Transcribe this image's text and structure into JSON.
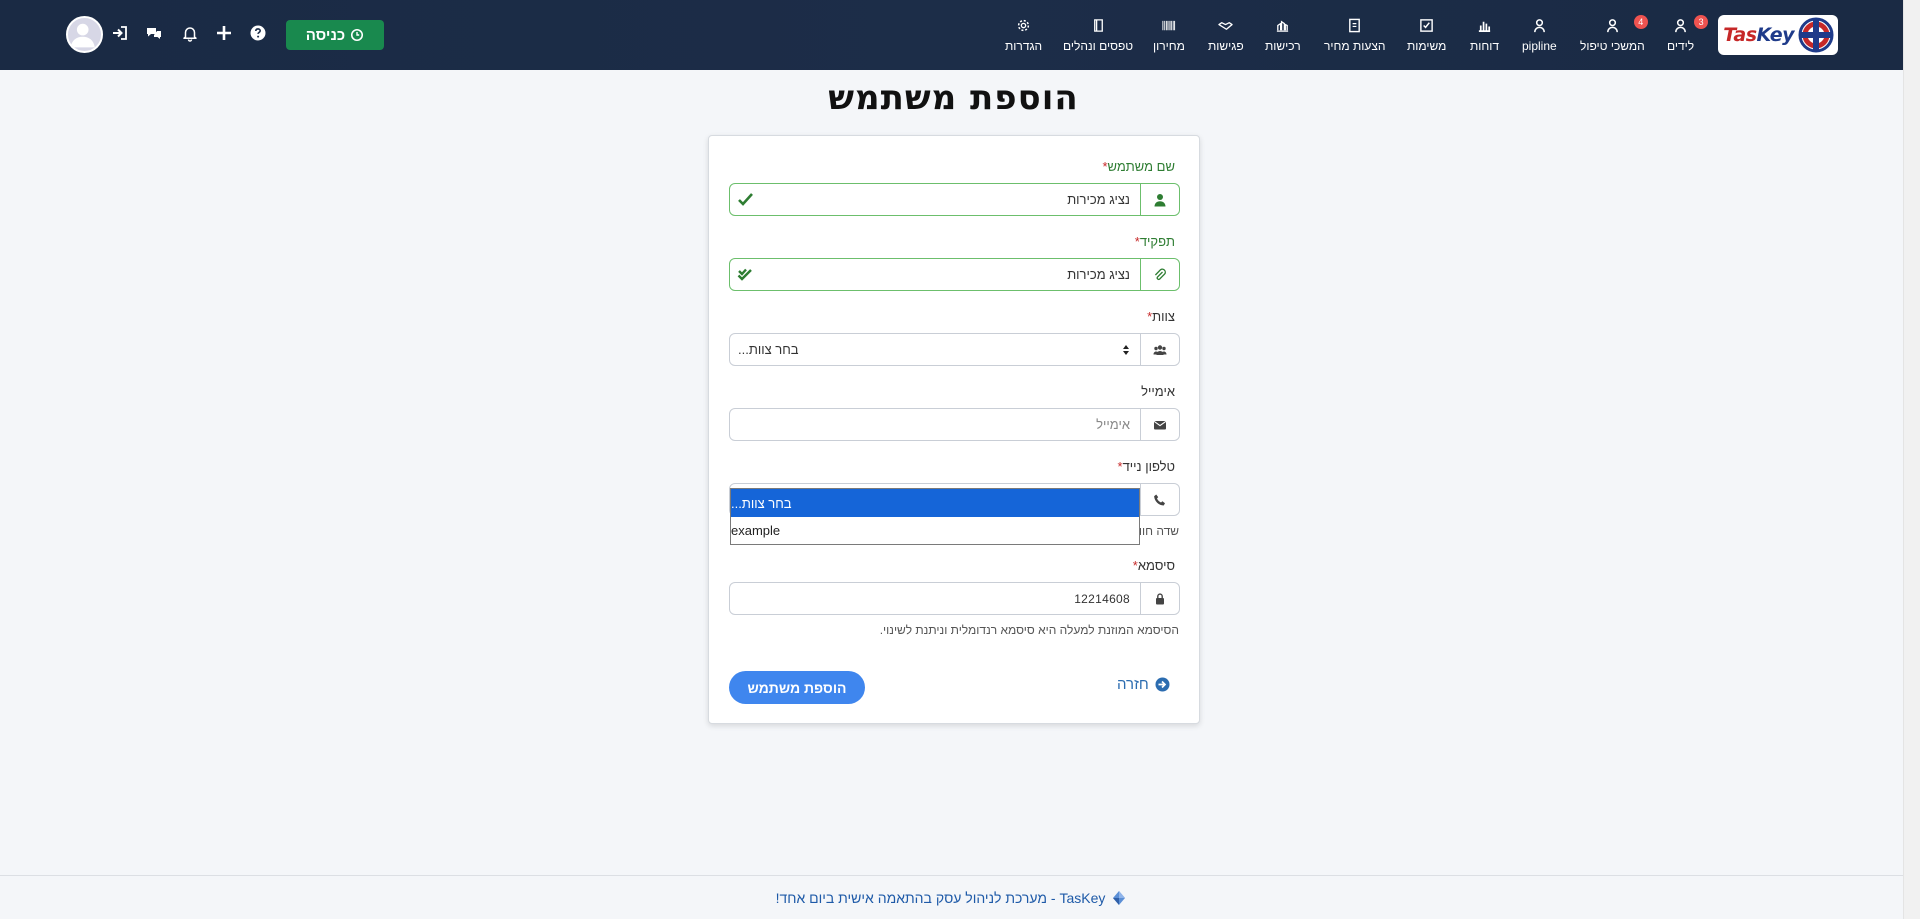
{
  "app": {
    "logo_text_a": "Tas",
    "logo_text_b": "Key"
  },
  "nav": {
    "items": [
      {
        "key": "leads",
        "label": "לידים",
        "icon": "user-icon",
        "badge": "3"
      },
      {
        "key": "followups",
        "label": "המשכי טיפול",
        "icon": "user-icon",
        "badge": "4"
      },
      {
        "key": "pipeline",
        "label": "pipline",
        "icon": "user-icon",
        "badge": ""
      },
      {
        "key": "reports",
        "label": "דוחות",
        "icon": "bar-chart-icon",
        "badge": ""
      },
      {
        "key": "tasks",
        "label": "משימות",
        "icon": "check-square-icon",
        "badge": ""
      },
      {
        "key": "quotes",
        "label": "הצעות מחיר",
        "icon": "document-icon",
        "badge": ""
      },
      {
        "key": "purchases",
        "label": "רכישות",
        "icon": "purchases-icon",
        "badge": ""
      },
      {
        "key": "meetings",
        "label": "פגישות",
        "icon": "handshake-icon",
        "badge": ""
      },
      {
        "key": "pricelist",
        "label": "מחירון",
        "icon": "barcode-icon",
        "badge": ""
      },
      {
        "key": "forms",
        "label": "טפסים ונהלים",
        "icon": "book-icon",
        "badge": ""
      },
      {
        "key": "settings",
        "label": "הגדרות",
        "icon": "gear-icon",
        "badge": ""
      }
    ],
    "clockin_label": "כניסה"
  },
  "page": {
    "title": "הוספת משתמש"
  },
  "form": {
    "username": {
      "label": "שם משתמש",
      "required_mark": "*",
      "value": "נציג מכירות"
    },
    "role": {
      "label": "תפקיד",
      "required_mark": "*",
      "value": "נציג מכירות"
    },
    "team": {
      "label": "צוות",
      "required_mark": "*",
      "value": "בחר צוות...",
      "options": [
        "בחר צוות...",
        "example"
      ],
      "selected_index": 0
    },
    "email": {
      "label": "אימייל",
      "placeholder": "אימייל",
      "value": ""
    },
    "phone": {
      "label": "טלפון נייד",
      "required_mark": "*",
      "help_partial": "שדה חוו"
    },
    "password": {
      "label": "סיסמא",
      "required_mark": "*",
      "value": "12214608",
      "help": "הסיסמא המוזנת למעלה היא סיסמא רנדומלית וניתנת לשינוי."
    },
    "back_label": "חזרה",
    "submit_label": "הוספת משתמש"
  },
  "footer": {
    "text": "TasKey - מערכת לניהול עסק בהתאמה אישית ביום אחד!"
  },
  "colors": {
    "navbar": "#1c2d48",
    "accent": "#3f86ee",
    "success": "#19894e",
    "valid": "#2e7d32",
    "badge": "#ef5350"
  }
}
